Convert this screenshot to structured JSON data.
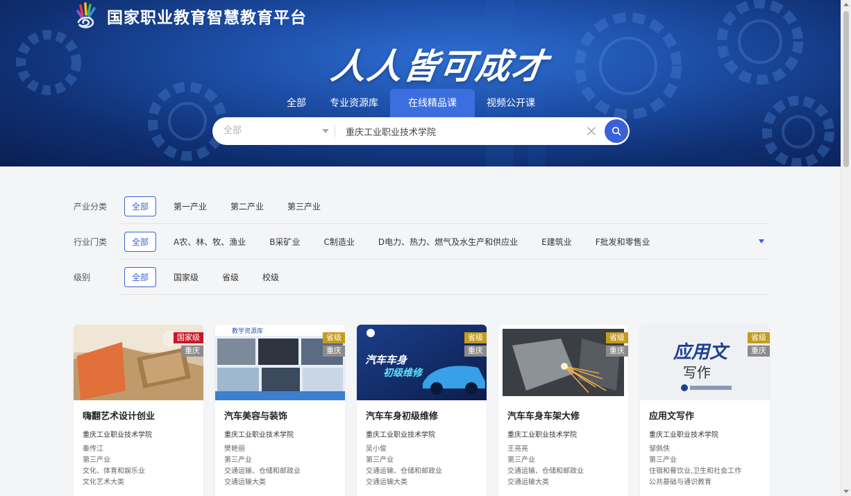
{
  "header": {
    "logo_text": "国家职业教育智慧教育平台",
    "slogan": "人人皆可成才",
    "tabs": [
      {
        "label": "全部",
        "active": false
      },
      {
        "label": "专业资源库",
        "active": false
      },
      {
        "label": "在线精品课",
        "active": true
      },
      {
        "label": "视频公开课",
        "active": false
      }
    ],
    "search": {
      "category_value": "全部",
      "query": "重庆工业职业技术学院",
      "search_icon": "search-icon",
      "clear_icon": "close-icon"
    }
  },
  "filters": [
    {
      "label": "产业分类",
      "options": [
        "全部",
        "第一产业",
        "第二产业",
        "第三产业"
      ],
      "active": 0,
      "expandable": false
    },
    {
      "label": "行业门类",
      "options": [
        "全部",
        "A农、林、牧、渔业",
        "B采矿业",
        "C制造业",
        "D电力、热力、燃气及水生产和供应业",
        "E建筑业",
        "F批发和零售业"
      ],
      "active": 0,
      "expandable": true
    },
    {
      "label": "级别",
      "options": [
        "全部",
        "国家级",
        "省级",
        "校级"
      ],
      "active": 0,
      "expandable": false
    }
  ],
  "courses": [
    {
      "title": "嗨翻艺术设计创业",
      "school": "重庆工业职业技术学院",
      "teacher": "秦传江",
      "industry_class": "第三产业",
      "industry": "文化、体育和娱乐业",
      "category": "文化艺术大类",
      "level": "国家级",
      "level_color": "#c8172b",
      "region": "重庆"
    },
    {
      "title": "汽车美容与装饰",
      "school": "重庆工业职业技术学院",
      "teacher": "樊艳丽",
      "industry_class": "第三产业",
      "industry": "交通运输、仓储和邮政业",
      "category": "交通运输大类",
      "level": "省级",
      "level_color": "#c59b1e",
      "region": "重庆",
      "thumb_label": "教学资源库"
    },
    {
      "title": "汽车车身初级维修",
      "school": "重庆工业职业技术学院",
      "teacher": "吴小俊",
      "industry_class": "第三产业",
      "industry": "交通运输、仓储和邮政业",
      "category": "交通运输大类",
      "level": "省级",
      "level_color": "#c59b1e",
      "region": "重庆",
      "thumb_label_1": "汽车车身",
      "thumb_label_2": "初级维修"
    },
    {
      "title": "汽车车身车架大修",
      "school": "重庆工业职业技术学院",
      "teacher": "王亮亮",
      "industry_class": "第三产业",
      "industry": "交通运输、仓储和邮政业",
      "category": "交通运输大类",
      "level": "省级",
      "level_color": "#c59b1e",
      "region": "重庆"
    },
    {
      "title": "应用文写作",
      "school": "重庆工业职业技术学院",
      "teacher": "邹佩佚",
      "industry_class": "第三产业",
      "industry": "住宿和餐饮业,卫生和社会工作",
      "category": "公共基础与通识教育",
      "level": "省级",
      "level_color": "#c59b1e",
      "region": "重庆",
      "thumb_label_1": "应用文",
      "thumb_label_2": "写作"
    }
  ]
}
